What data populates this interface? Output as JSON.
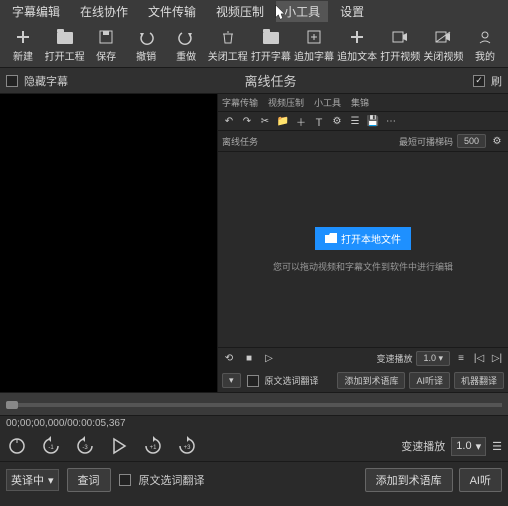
{
  "menubar": [
    "字幕编辑",
    "在线协作",
    "文件传输",
    "视频压制",
    "小工具",
    "设置"
  ],
  "menubar_hover_index": 4,
  "toolbar": [
    {
      "label": "新建",
      "icon": "plus"
    },
    {
      "label": "打开工程",
      "icon": "folder"
    },
    {
      "label": "保存",
      "icon": "save"
    },
    {
      "label": "撤销",
      "icon": "undo"
    },
    {
      "label": "重做",
      "icon": "redo"
    },
    {
      "label": "关闭工程",
      "icon": "trash"
    },
    {
      "label": "打开字幕",
      "icon": "folder-up"
    },
    {
      "label": "追加字幕",
      "icon": "plus-box"
    },
    {
      "label": "追加文本",
      "icon": "plus"
    },
    {
      "label": "打开视频",
      "icon": "video"
    },
    {
      "label": "关闭视频",
      "icon": "video-off"
    },
    {
      "label": "我的",
      "icon": "user"
    }
  ],
  "subbar": {
    "hide_subs_label": "隐藏字幕",
    "offline_title": "离线任务",
    "right_checked": true,
    "right_label": "刷"
  },
  "offline_panel": {
    "tabs": [
      "字幕传输",
      "视频压制",
      "小工具",
      "集锦"
    ],
    "row2_left": "离线任务",
    "row2_right_label": "最短可播梯码",
    "row2_right_value": "500",
    "open_btn_label": "打开本地文件",
    "hint": "您可以拖动视频和字幕文件到软件中进行编辑",
    "bottom": {
      "speed_label": "变速播放",
      "speed_value": "1.0",
      "src_label": "原文选词翻译",
      "pill1": "添加到术语库",
      "pill2": "AI听译",
      "pill3": "机器翻译"
    }
  },
  "timecode": "00;00;00,000/00:00:05,367",
  "speed_label": "变速播放",
  "speed_value": "1.0",
  "bottom": {
    "lang_value": "英译中",
    "search_btn": "查词",
    "src_trans_label": "原文选词翻译",
    "btn_term": "添加到术语库",
    "btn_ai": "AI听"
  }
}
